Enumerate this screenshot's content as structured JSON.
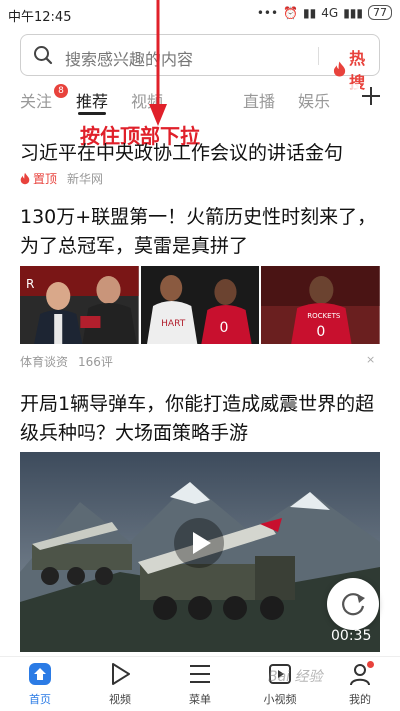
{
  "status_bar": {
    "time": "中午12:45",
    "network": "4G",
    "battery": "77"
  },
  "search": {
    "placeholder": "搜索感兴趣的内容",
    "hot_label": "热搜"
  },
  "tabs": [
    {
      "label": "关注",
      "badge": "8"
    },
    {
      "label": "推荐",
      "active": true
    },
    {
      "label": "视频"
    },
    {
      "label": "直播"
    },
    {
      "label": "娱乐"
    }
  ],
  "annotation": {
    "text": "按住顶部下拉"
  },
  "feed": [
    {
      "title": "习近平在中央政协工作会议的讲话金句",
      "pinned_label": "置顶",
      "source": "新华网"
    },
    {
      "title": "130万+联盟第一！火箭历史性时刻来了，为了总冠军，莫雷是真拼了",
      "source": "体育谈资",
      "comments": "166评",
      "dismiss": "×"
    },
    {
      "title": "开局1辆导弹车，你能打造成威震世界的超级兵种吗？大场面策略手游",
      "duration": "00:35"
    }
  ],
  "bottom_nav": [
    {
      "label": "首页",
      "icon": "home-icon",
      "active": true
    },
    {
      "label": "视频",
      "icon": "play-icon"
    },
    {
      "label": "菜单",
      "icon": "menu-icon"
    },
    {
      "label": "小视频",
      "icon": "short-video-icon"
    },
    {
      "label": "我的",
      "icon": "user-icon"
    }
  ],
  "colors": {
    "accent_red": "#e8423c",
    "active_blue": "#2b7be5",
    "annotation_red": "#e0202a"
  }
}
